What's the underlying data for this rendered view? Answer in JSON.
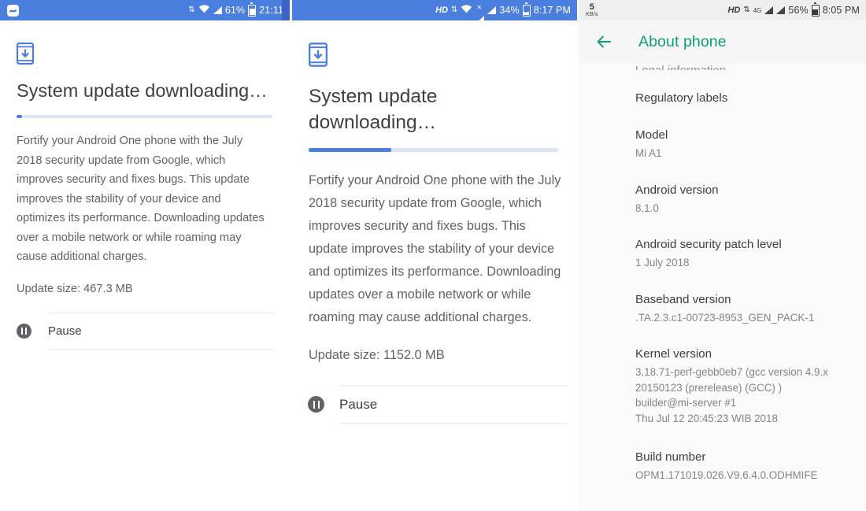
{
  "panels": [
    {
      "id": "download-small",
      "statusbar": {
        "app_icon": "download-notification-icon",
        "battery_percent": "61%",
        "time": "21:11",
        "icons": [
          "data-transfer-icon",
          "wifi-icon",
          "signal-icon",
          "battery-icon"
        ],
        "background": "#4a7fe0"
      },
      "icon": "system-update-download-icon",
      "title": "System update downloading…",
      "progress_percent": 2,
      "description": "Fortify your Android One phone with the July 2018 security update from Google, which improves security and fixes bugs. This update improves the stability of your device and optimizes its performance. Downloading updates over a mobile network or while roaming may cause additional charges.",
      "update_size": "Update size: 467.3 MB",
      "action_label": "Pause",
      "action_icon": "pause-circle-icon"
    },
    {
      "id": "download-large",
      "statusbar": {
        "hd_label": "HD",
        "network_label": "",
        "battery_percent": "34%",
        "time": "8:17 PM",
        "icons": [
          "hd-icon",
          "data-transfer-icon",
          "wifi-icon",
          "signal-icon",
          "signal-icon",
          "battery-charging-icon"
        ],
        "background": "#4a7fe0"
      },
      "icon": "system-update-download-icon",
      "title": "System update downloading…",
      "progress_percent": 33,
      "description": "Fortify your Android One phone with the July 2018 security update from Google, which improves security and fixes bugs. This update improves the stability of your device and optimizes its performance. Downloading updates over a mobile network or while roaming may cause additional charges.",
      "update_size": "Update size: 1152.0 MB",
      "action_label": "Pause",
      "action_icon": "pause-circle-icon"
    }
  ],
  "about": {
    "statusbar": {
      "net_speed_value": "5",
      "net_speed_unit": "KB/s",
      "hd_label": "HD",
      "network_label": "4G",
      "battery_percent": "56%",
      "time": "8:05 PM",
      "icons": [
        "hd-icon",
        "data-transfer-icon",
        "signal-icon",
        "signal-icon",
        "battery-icon"
      ],
      "background": "#efefef"
    },
    "back_icon": "back-arrow-icon",
    "title": "About phone",
    "clipped_item": "Legal information",
    "items": [
      {
        "label": "Regulatory labels",
        "value": ""
      },
      {
        "label": "Model",
        "value": "Mi A1"
      },
      {
        "label": "Android version",
        "value": "8.1.0"
      },
      {
        "label": "Android security patch level",
        "value": "1 July 2018"
      },
      {
        "label": "Baseband version",
        "value": ".TA.2.3.c1-00723-8953_GEN_PACK-1"
      },
      {
        "label": "Kernel version",
        "value": "3.18.71-perf-gebb0eb7 (gcc version 4.9.x\n20150123 (prerelease) (GCC) )\nbuilder@mi-server #1\nThu Jul 12 20:45:23 WIB 2018"
      },
      {
        "label": "Build number",
        "value": "OPM1.171019.026.V9.6.4.0.ODHMIFE"
      }
    ]
  },
  "colors": {
    "status_blue": "#4a7fe0",
    "accent_blue": "#4a7fe0",
    "accent_teal": "#0f9d76",
    "text_primary": "#3c4043",
    "text_secondary": "#5f6368",
    "text_tertiary": "#80868b"
  }
}
